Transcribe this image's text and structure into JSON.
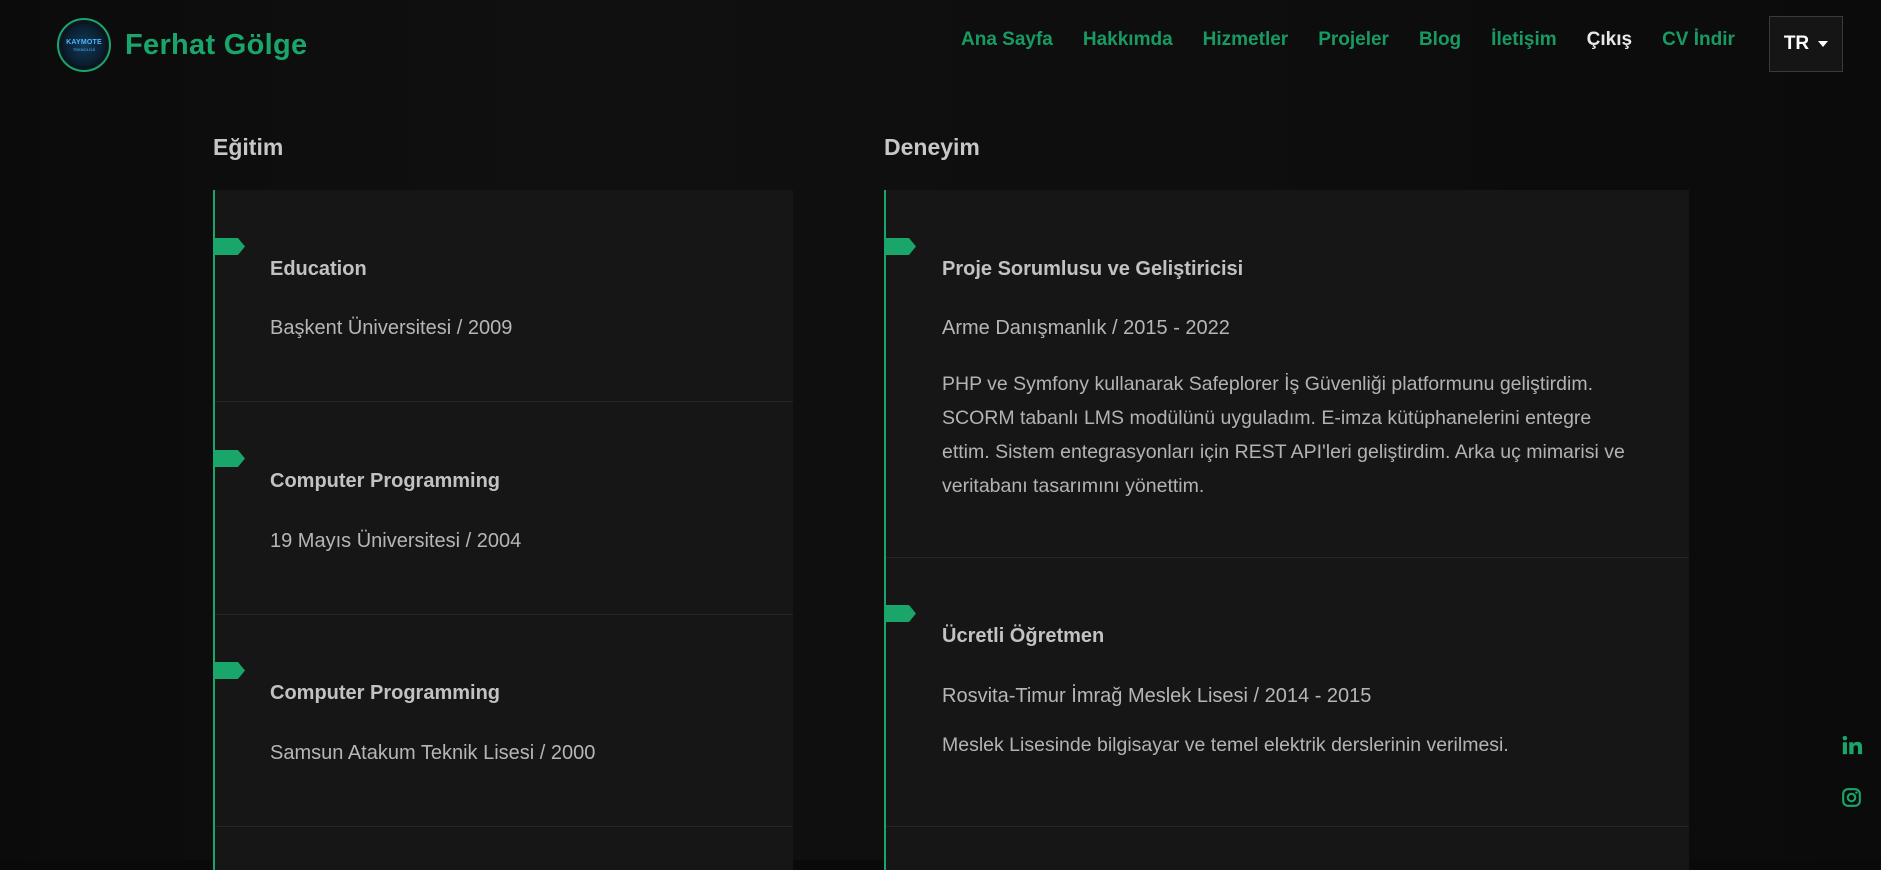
{
  "brand": {
    "name": "Ferhat Gölge",
    "logo_text_top": "KAYMOTE",
    "logo_text_bottom": "TEKNOLOJİ"
  },
  "nav": {
    "items": [
      "Ana Sayfa",
      "Hakkımda",
      "Hizmetler",
      "Projeler",
      "Blog",
      "İletişim",
      "Çıkış",
      "CV İndir"
    ],
    "language": "TR"
  },
  "education": {
    "title": "Eğitim",
    "items": [
      {
        "title": "Education",
        "sub": "Başkent Üniversitesi / 2009"
      },
      {
        "title": "Computer Programming",
        "sub": "19 Mayıs Üniversitesi / 2004"
      },
      {
        "title": "Computer Programming",
        "sub": "Samsun Atakum Teknik Lisesi / 2000"
      }
    ]
  },
  "experience": {
    "title": "Deneyim",
    "items": [
      {
        "title": "Proje Sorumlusu ve Geliştiricisi",
        "sub": "Arme Danışmanlık / 2015 - 2022",
        "desc_lines": [
          "PHP ve Symfony kullanarak Safeplorer İş Güvenliği platformunu geliştirdim.",
          "SCORM tabanlı LMS modülünü uyguladım. E-imza kütüphanelerini entegre",
          "ettim. Sistem entegrasyonları için REST API'leri geliştirdim. Arka uç mimarisi ve",
          "veritabanı tasarımını yönettim."
        ]
      },
      {
        "title": "Ücretli Öğretmen",
        "sub": "Rosvita-Timur İmrağ Meslek Lisesi / 2014 - 2015",
        "desc_lines": [
          "Meslek Lisesinde bilgisayar ve temel elektrik derslerinin verilmesi."
        ]
      }
    ]
  },
  "social": {
    "icons": [
      "linkedin-icon",
      "instagram-icon"
    ]
  },
  "colors": {
    "accent": "#1aa56a",
    "background": "#0e0e0e",
    "panel": "#161616"
  }
}
